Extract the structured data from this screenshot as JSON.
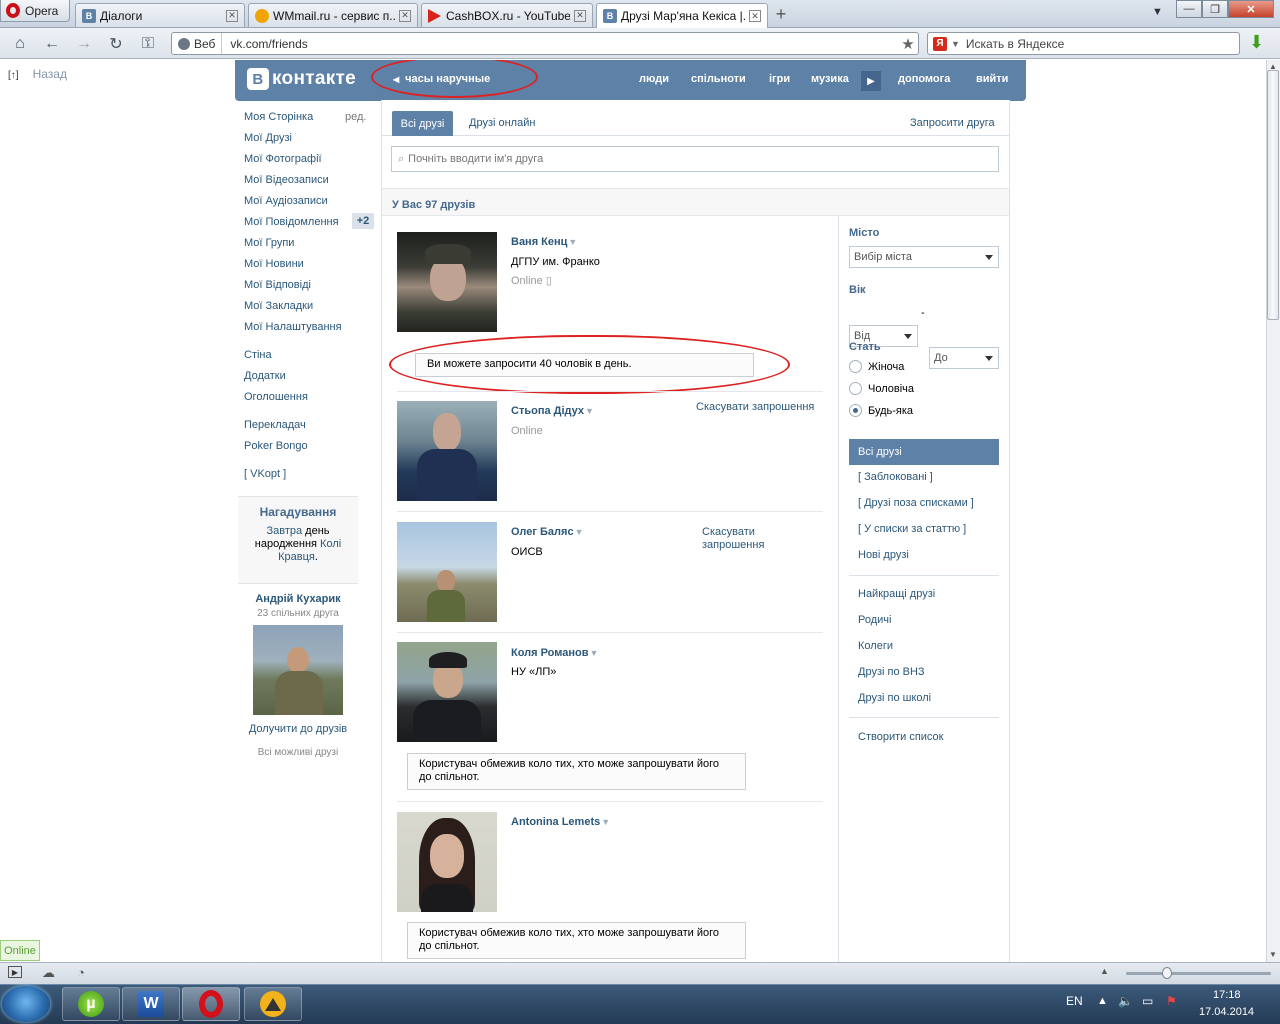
{
  "browser": {
    "menu_label": "Opera",
    "tabs": [
      {
        "title": "Діалоги",
        "fav_color": "#5e81a8",
        "fav_letter": "В"
      },
      {
        "title": "WMmail.ru - сервис п...",
        "fav_color": "#f0a400",
        "fav_letter": ""
      },
      {
        "title": "CashBOX.ru - YouTube...",
        "fav_color": "#d8251b",
        "fav_letter": ""
      },
      {
        "title": "Друзі Мар'яна Кекіса |...",
        "fav_color": "#5e81a8",
        "fav_letter": "В"
      }
    ],
    "new_tab": "+",
    "web_label": "Веб",
    "url": "vk.com/friends",
    "search_placeholder": "Искать в Яндексе",
    "yandex_letter": "Я"
  },
  "page": {
    "back_icon": "[↑]",
    "back_label": "Назад"
  },
  "vk": {
    "logo_letter": "В",
    "logo_text": "контакте",
    "status_text": "часы наручные",
    "nav": [
      "люди",
      "спільноти",
      "ігри",
      "музика",
      "допомога",
      "вийти"
    ],
    "menu": [
      "Моя Сторінка",
      "Мої Друзі",
      "Мої Фотографії",
      "Мої Відеозаписи",
      "Мої Аудіозаписи",
      "Мої Повідомлення",
      "Мої Групи",
      "Мої Новини",
      "Мої Відповіді",
      "Мої Закладки",
      "Мої Налаштування"
    ],
    "menu_edit": "ред.",
    "messages_badge": "+2",
    "menu2": [
      "Стіна",
      "Додатки",
      "Оголошення"
    ],
    "menu3": [
      "Перекладач",
      "Poker Bongo"
    ],
    "menu4": "[ VKopt ]",
    "reminder": {
      "title": "Нагадування",
      "tomorrow": "Завтра",
      "day": "день",
      "birthday": "народження",
      "name1": "Колі",
      "name2": "Кравця",
      "dot": "."
    },
    "suggest": {
      "name": "Андрій Кухарик",
      "mutual": "23 спільних друга",
      "add": "Долучити до друзів",
      "all": "Всі можливі друзі"
    },
    "tabs": {
      "all": "Всі друзі",
      "online": "Друзі онлайн",
      "invite": "Запросити друга"
    },
    "search_placeholder": "Почніть вводити ім'я друга",
    "search_icon": "⌕",
    "count": "У Вас 97 друзів",
    "friends": [
      {
        "name": "Ваня Кенц",
        "info": "ДГПУ им. Франко",
        "status": "Online",
        "mobile_icon": "▯"
      },
      {
        "invite_limit": "Ви можете запросити 40 чоловік в день."
      },
      {
        "name": "Стьопа Дідух",
        "status": "Online",
        "action": "Скасувати запрошення"
      },
      {
        "name": "Олег Баляс",
        "info": "ОИСВ",
        "action1": "Скасувати",
        "action2": "запрошення"
      },
      {
        "name": "Коля Романов",
        "info": "НУ «ЛП»",
        "note1": "Користувач обмежив коло тих, хто може запрошувати його",
        "note2": "до спільнот."
      },
      {
        "name": "Antonina Lemets",
        "note1": "Користувач обмежив коло тих, хто може запрошувати його",
        "note2": "до спільнот."
      }
    ],
    "filters": {
      "city_label": "Місто",
      "city_value": "Вибір міста",
      "age_label": "Вік",
      "age_from": "Від",
      "age_dash": "-",
      "age_to": "До",
      "sex_label": "Стать",
      "sex_options": [
        "Жіноча",
        "Чоловіча",
        "Будь-яка"
      ],
      "sex_selected": 2,
      "lists_active": "Всі друзі",
      "lists1": [
        "[ Заблоковані ]",
        "[ Друзі поза списками ]",
        "[ У списки за статтю ]",
        "Нові друзі"
      ],
      "lists2": [
        "Найкращі друзі",
        "Родичі",
        "Колеги",
        "Друзі по ВНЗ",
        "Друзі по школі"
      ],
      "create": "Створити список"
    },
    "accent_color": "#5e81a8",
    "link_color": "#2b587a"
  },
  "statusbar": {
    "online": "Online"
  },
  "taskbar": {
    "lang": "EN",
    "time": "17:18",
    "date": "17.04.2014"
  }
}
